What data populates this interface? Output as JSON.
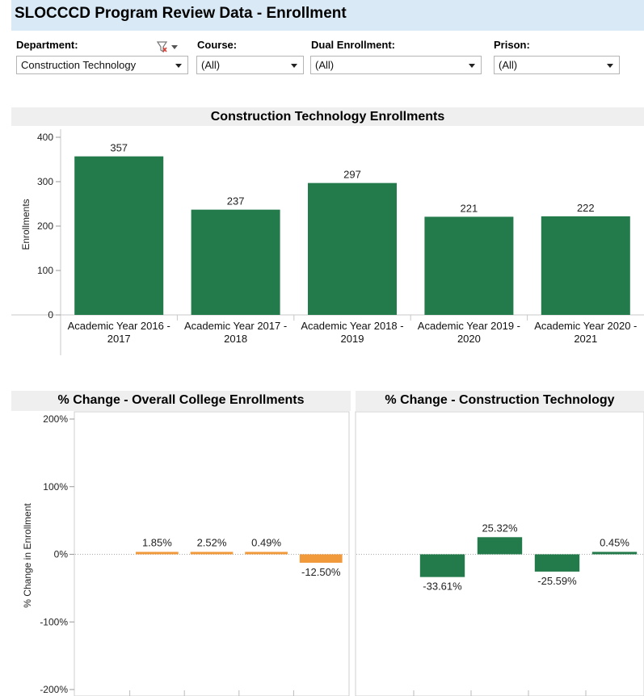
{
  "header": {
    "title": "SLOCCCD Program Review Data - Enrollment"
  },
  "filters": {
    "department": {
      "label": "Department:",
      "value": "Construction Technology"
    },
    "course": {
      "label": "Course:",
      "value": "(All)"
    },
    "dual_enrollment": {
      "label": "Dual Enrollment:",
      "value": "(All)"
    },
    "prison": {
      "label": "Prison:",
      "value": "(All)"
    }
  },
  "colors": {
    "green": "#237a4a",
    "orange": "#f09a3c",
    "header_bg": "#d9e9f6"
  },
  "chart_data": [
    {
      "type": "bar",
      "title": "Construction Technology Enrollments",
      "ylabel": "Enrollments",
      "categories": [
        [
          "Academic Year 2016 -",
          "2017"
        ],
        [
          "Academic Year 2017 -",
          "2018"
        ],
        [
          "Academic Year 2018 -",
          "2019"
        ],
        [
          "Academic Year 2019 -",
          "2020"
        ],
        [
          "Academic Year 2020 -",
          "2021"
        ]
      ],
      "values": [
        357,
        237,
        297,
        221,
        222
      ],
      "data_labels": [
        "357",
        "237",
        "297",
        "221",
        "222"
      ],
      "ylim": [
        0,
        400
      ],
      "yticks": [
        "0",
        "100",
        "200",
        "300",
        "400"
      ],
      "color": "#237a4a"
    },
    {
      "type": "bar",
      "title": "% Change - Overall College Enrollments",
      "ylabel": "% Change in Enrollment",
      "values": [
        null,
        1.85,
        2.52,
        0.49,
        -12.5
      ],
      "data_labels": [
        "",
        "1.85%",
        "2.52%",
        "0.49%",
        "-12.50%"
      ],
      "ylim": [
        -200,
        200
      ],
      "yticks": [
        "-200%",
        "-100%",
        "0%",
        "100%",
        "200%"
      ],
      "color": "#f09a3c"
    },
    {
      "type": "bar",
      "title": "% Change - Construction Technology",
      "values": [
        null,
        -33.61,
        25.32,
        -25.59,
        0.45
      ],
      "data_labels": [
        "",
        "-33.61%",
        "25.32%",
        "-25.59%",
        "0.45%"
      ],
      "ylim": [
        -200,
        200
      ],
      "color": "#237a4a"
    }
  ]
}
